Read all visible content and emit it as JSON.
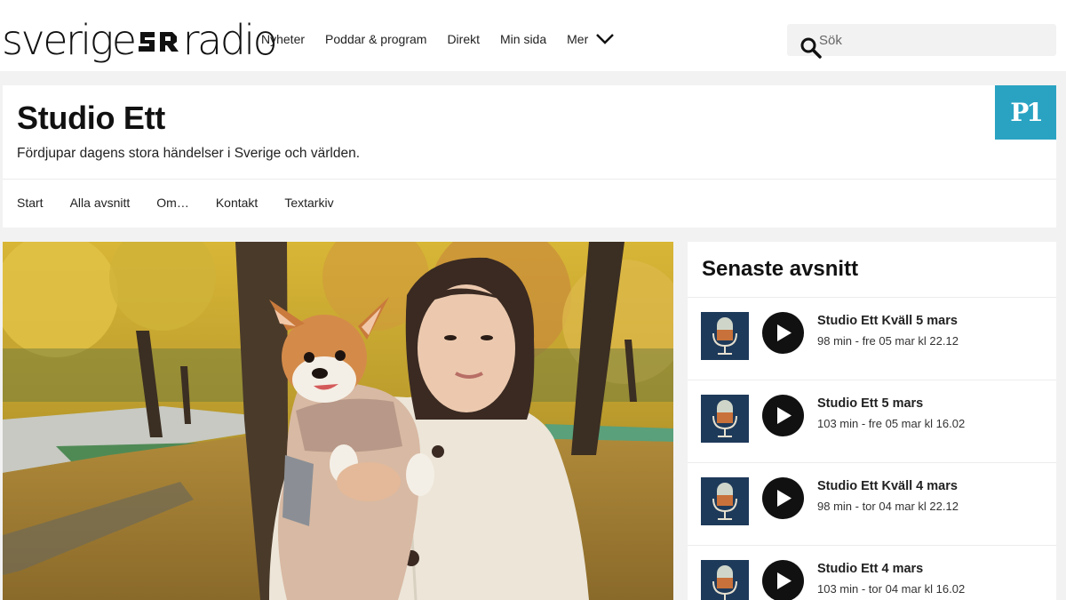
{
  "brand": {
    "logo_left": "sverige",
    "logo_right": "radio",
    "accent": "#2aa3c3"
  },
  "nav": {
    "items": [
      {
        "label": "Nyheter"
      },
      {
        "label": "Poddar & program"
      },
      {
        "label": "Direkt"
      },
      {
        "label": "Min sida"
      },
      {
        "label": "Mer"
      }
    ]
  },
  "search": {
    "placeholder": "Sök",
    "icon": "search-icon"
  },
  "program": {
    "title": "Studio Ett",
    "description": "Fördjupar dagens stora händelser i Sverige och världen.",
    "channel_badge": "P1",
    "subnav": [
      {
        "label": "Start"
      },
      {
        "label": "Alla avsnitt"
      },
      {
        "label": "Om…"
      },
      {
        "label": "Kontakt"
      },
      {
        "label": "Textarkiv"
      }
    ]
  },
  "hero": {
    "icon": "hero-photo"
  },
  "latest": {
    "title": "Senaste avsnitt",
    "episodes": [
      {
        "title": "Studio Ett Kväll 5 mars",
        "meta": "98 min  -  fre 05 mar kl 22.12"
      },
      {
        "title": "Studio Ett 5 mars",
        "meta": "103 min  -  fre 05 mar kl 16.02"
      },
      {
        "title": "Studio Ett Kväll 4 mars",
        "meta": "98 min  -  tor 04 mar kl 22.12"
      },
      {
        "title": "Studio Ett 4 mars",
        "meta": "103 min  -  tor 04 mar kl 16.02"
      }
    ]
  }
}
